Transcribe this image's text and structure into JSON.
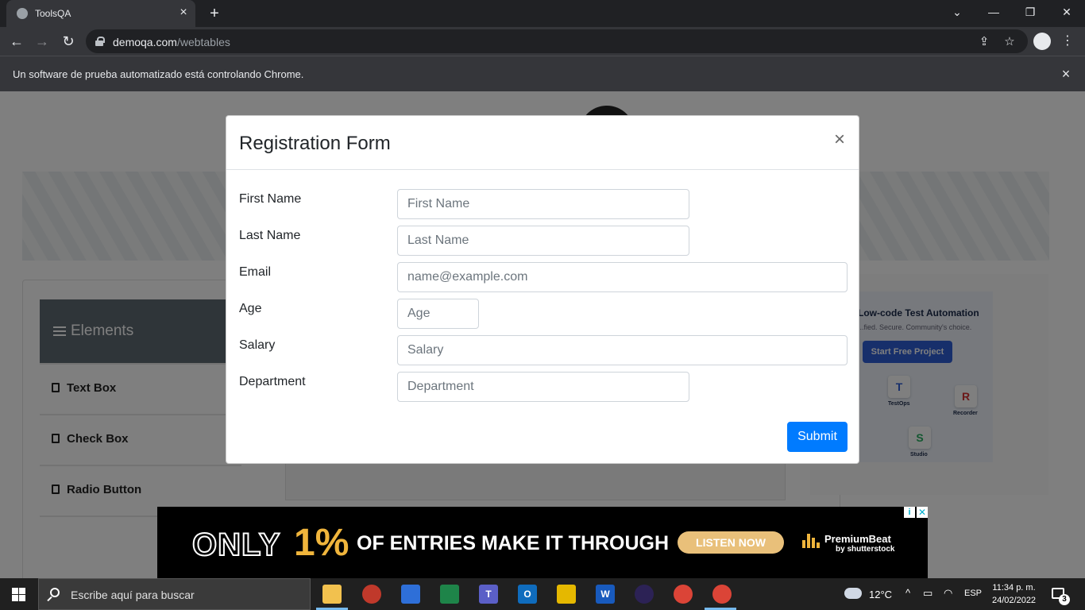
{
  "browser": {
    "tab_title": "ToolsQA",
    "url_host": "demoqa.com",
    "url_path": "/webtables",
    "infobar_message": "Un software de prueba automatizado está controlando Chrome."
  },
  "page": {
    "sidebar_header": "Elements",
    "menu_items": [
      "Text Box",
      "Check Box",
      "Radio Button"
    ],
    "side_ad": {
      "headline": "Low-code Test Automation",
      "subline": "...fied. Secure. Community's choice.",
      "cta": "Start Free Project",
      "tiles": [
        {
          "letter": "T",
          "caption": "TestOps",
          "color": "#2f5fd6"
        },
        {
          "letter": "R",
          "caption": "Recorder",
          "color": "#d63031"
        },
        {
          "letter": "S",
          "caption": "Studio",
          "color": "#27ae60"
        }
      ]
    }
  },
  "modal": {
    "title": "Registration Form",
    "close_symbol": "×",
    "fields": [
      {
        "label": "First Name",
        "placeholder": "First Name",
        "value": ""
      },
      {
        "label": "Last Name",
        "placeholder": "Last Name",
        "value": ""
      },
      {
        "label": "Email",
        "placeholder": "name@example.com",
        "value": ""
      },
      {
        "label": "Age",
        "placeholder": "Age",
        "value": ""
      },
      {
        "label": "Salary",
        "placeholder": "Salary",
        "value": ""
      },
      {
        "label": "Department",
        "placeholder": "Department",
        "value": ""
      }
    ],
    "submit_label": "Submit",
    "primary_color": "#007bff"
  },
  "bottom_ad": {
    "only": "ONLY",
    "percent": "1%",
    "tagline": "OF ENTRIES MAKE IT THROUGH",
    "cta": "LISTEN NOW",
    "brand": "PremiumBeat",
    "brand_by": "by shutterstock"
  },
  "taskbar": {
    "search_placeholder": "Escribe aquí para buscar",
    "temperature": "12°C",
    "language": "ESP",
    "time": "11:34 p. m.",
    "date": "24/02/2022",
    "notification_count": "3"
  }
}
